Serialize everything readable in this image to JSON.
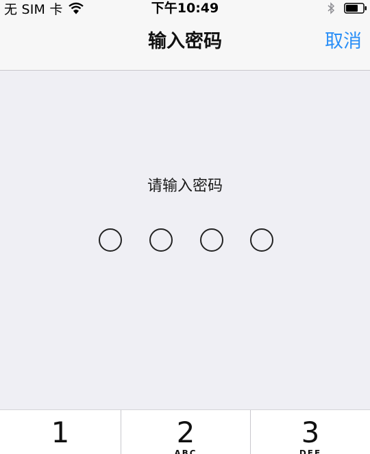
{
  "status_bar": {
    "carrier": "无 SIM 卡",
    "time": "下午10:49",
    "icons": [
      "wifi-icon",
      "bluetooth-icon",
      "battery-icon"
    ]
  },
  "nav": {
    "title": "输入密码",
    "cancel_label": "取消"
  },
  "content": {
    "prompt": "请输入密码",
    "passcode_length": 4,
    "entered_digits": 0
  },
  "keypad": {
    "keys": [
      {
        "number": "1",
        "letters": ""
      },
      {
        "number": "2",
        "letters": "ABC"
      },
      {
        "number": "3",
        "letters": "DEF"
      }
    ]
  },
  "colors": {
    "accent": "#2a8ff7",
    "background": "#efeff4",
    "bar": "#f7f7f7"
  }
}
